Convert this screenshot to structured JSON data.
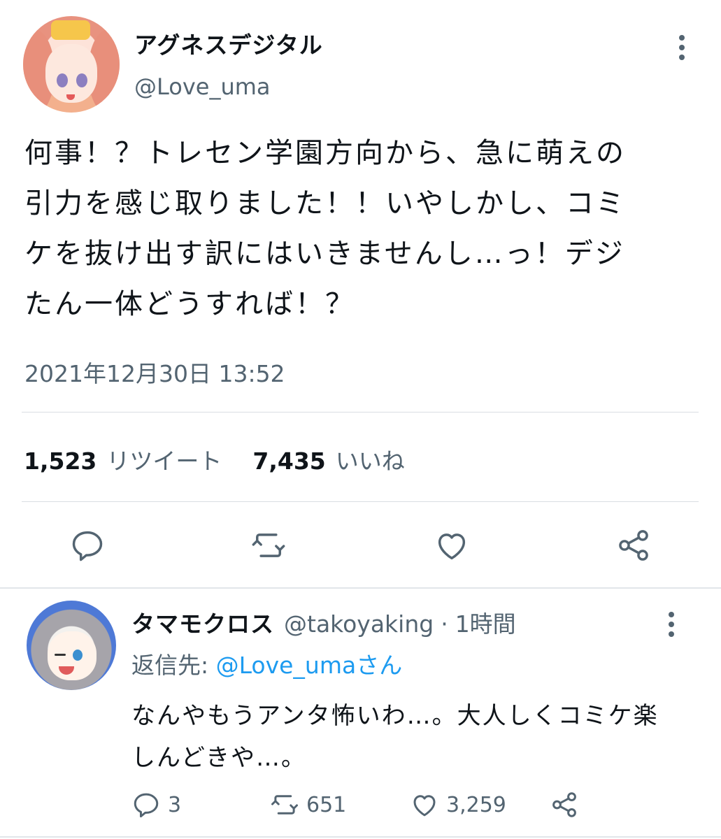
{
  "tweet": {
    "display_name": "アグネスデジタル",
    "handle": "@Love_uma",
    "text": "何事！？トレセン学園方向から、急に萌えの\n引力を感じ取りました！！いやしかし、コミ\nケを抜け出す訳にはいきませんし…っ！デジ\nたん一体どうすれば！？",
    "timestamp": "2021年12月30日 13:52",
    "stats": {
      "retweets_count": "1,523",
      "retweets_label": "リツイート",
      "likes_count": "7,435",
      "likes_label": "いいね"
    },
    "actions": [
      "reply-icon",
      "retweet-icon",
      "like-icon",
      "share-icon"
    ]
  },
  "reply": {
    "display_name": "タマモクロス",
    "handle": "@takoyaking",
    "separator": "·",
    "time": "1時間",
    "reply_to_label": "返信先: ",
    "reply_to_mention": "@Love_umaさん",
    "text": "なんやもうアンタ怖いわ…。大人しくコミケ楽\nしんどきや…。",
    "counts": {
      "replies": "3",
      "retweets": "651",
      "likes": "3,259"
    }
  },
  "colors": {
    "text": "#0f1419",
    "secondary": "#536471",
    "link": "#1d9bf0",
    "divider": "#d9dee3"
  }
}
